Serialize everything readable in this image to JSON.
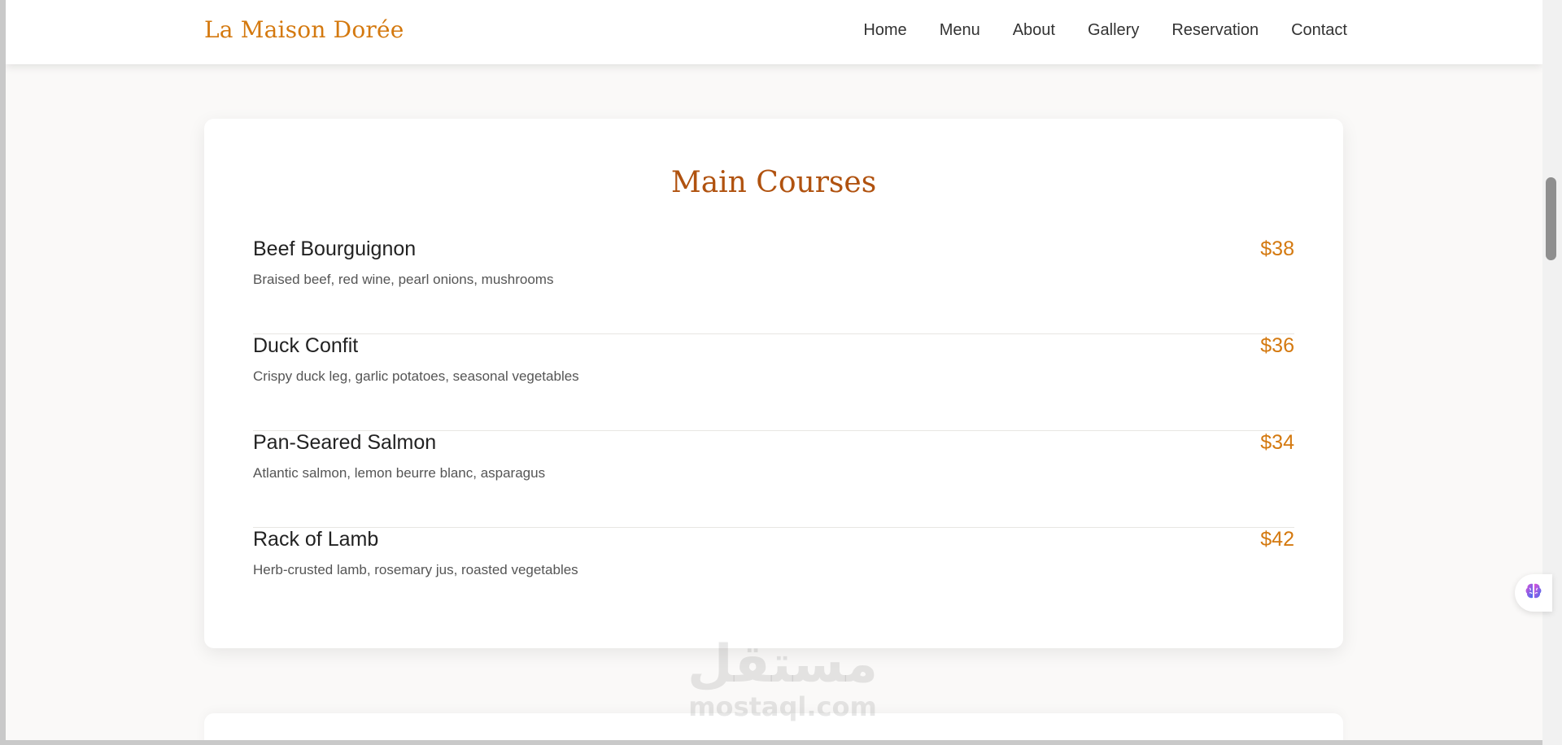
{
  "header": {
    "brand": "La Maison Dorée",
    "nav": [
      "Home",
      "Menu",
      "About",
      "Gallery",
      "Reservation",
      "Contact"
    ]
  },
  "section": {
    "title": "Main Courses",
    "items": [
      {
        "name": "Beef Bourguignon",
        "description": "Braised beef, red wine, pearl onions, mushrooms",
        "price": "$38"
      },
      {
        "name": "Duck Confit",
        "description": "Crispy duck leg, garlic potatoes, seasonal vegetables",
        "price": "$36"
      },
      {
        "name": "Pan-Seared Salmon",
        "description": "Atlantic salmon, lemon beurre blanc, asparagus",
        "price": "$34"
      },
      {
        "name": "Rack of Lamb",
        "description": "Herb-crusted lamb, rosemary jus, roasted vegetables",
        "price": "$42"
      }
    ]
  },
  "watermark": {
    "arabic": "مستقل",
    "latin": "mostaql.com"
  },
  "colors": {
    "accent": "#d4790f",
    "title": "#b0520f",
    "background": "#faf9f8"
  },
  "icons": {
    "float_button": "brain-icon"
  }
}
